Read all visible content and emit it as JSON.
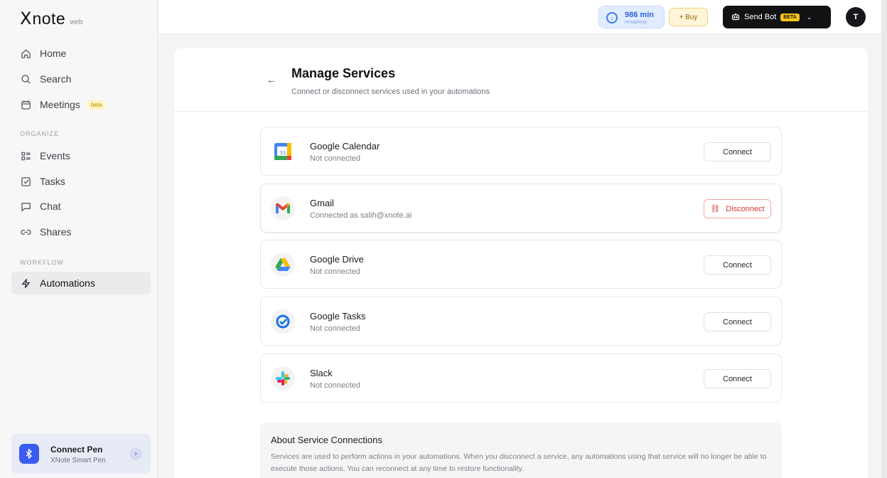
{
  "app": {
    "logo_x": "X",
    "logo_text": "note",
    "logo_suffix": "web"
  },
  "sidebar": {
    "nav": [
      {
        "label": "Home",
        "icon": "home-icon"
      },
      {
        "label": "Search",
        "icon": "search-icon"
      },
      {
        "label": "Meetings",
        "icon": "calendar-icon",
        "badge": "beta"
      }
    ],
    "organize_label": "ORGANIZE",
    "organize": [
      {
        "label": "Events",
        "icon": "events-icon"
      },
      {
        "label": "Tasks",
        "icon": "checkbox-icon"
      },
      {
        "label": "Chat",
        "icon": "chat-icon"
      },
      {
        "label": "Shares",
        "icon": "link-icon"
      }
    ],
    "workflow_label": "WORKFLOW",
    "workflow": [
      {
        "label": "Automations",
        "icon": "lightning-icon",
        "active": true
      }
    ],
    "pen": {
      "title": "Connect Pen",
      "subtitle": "XNote Smart Pen"
    }
  },
  "topbar": {
    "minutes_value": "986 min",
    "minutes_label": "remaining",
    "buy_label": "+ Buy",
    "send_bot_label": "Send Bot",
    "send_bot_badge": "BETA",
    "avatar_initial": "T"
  },
  "page": {
    "title": "Manage Services",
    "subtitle": "Connect or disconnect services used in your automations"
  },
  "services": [
    {
      "name": "Google Calendar",
      "status": "Not connected",
      "action": "Connect",
      "icon": "google-calendar-icon"
    },
    {
      "name": "Gmail",
      "status": "Connected as salih@xnote.ai",
      "action": "Disconnect",
      "icon": "gmail-icon"
    },
    {
      "name": "Google Drive",
      "status": "Not connected",
      "action": "Connect",
      "icon": "google-drive-icon"
    },
    {
      "name": "Google Tasks",
      "status": "Not connected",
      "action": "Connect",
      "icon": "google-tasks-icon"
    },
    {
      "name": "Slack",
      "status": "Not connected",
      "action": "Connect",
      "icon": "slack-icon"
    }
  ],
  "about": {
    "title": "About Service Connections",
    "text": "Services are used to perform actions in your automations. When you disconnect a service, any automations using that service will no longer be able to execute those actions. You can reconnect at any time to restore functionality."
  }
}
